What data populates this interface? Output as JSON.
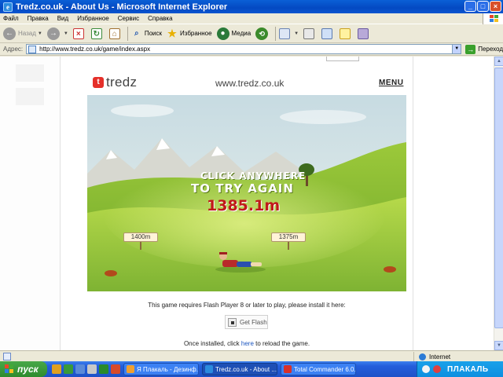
{
  "window": {
    "title": "Tredz.co.uk - About Us - Microsoft Internet Explorer"
  },
  "menubar": [
    "Файл",
    "Правка",
    "Вид",
    "Избранное",
    "Сервис",
    "Справка"
  ],
  "toolbar": {
    "back": "Назад",
    "search": "Поиск",
    "favorites": "Избранное",
    "media": "Медиа"
  },
  "addressbar": {
    "label": "Адрес:",
    "url": "http://www.tredz.co.uk/game/index.aspx",
    "go": "Переход"
  },
  "site": {
    "logo_text": "tredz",
    "url": "www.tredz.co.uk",
    "menu": "MENU"
  },
  "game": {
    "line1": "CLICK ANYWHERE",
    "line2": "TO TRY AGAIN",
    "score": "1385.1m",
    "marker_left": "1400m",
    "marker_right": "1375m"
  },
  "flash": {
    "message": "This game requires Flash Player 8 or later to play, please install it here:",
    "button": "Get Flash",
    "reload_prefix": "Once installed, click ",
    "reload_link": "here",
    "reload_suffix": " to reload the game."
  },
  "statusbar": {
    "zone": "Internet"
  },
  "taskbar": {
    "start": "пуск",
    "tasks": [
      {
        "label": "Я Плакаль - Дезинф...",
        "color": "#f0a030"
      },
      {
        "label": "Tredz.co.uk - About ...",
        "color": "#2b8bde"
      },
      {
        "label": "Total Commander 6.0...",
        "color": "#d8302a"
      }
    ],
    "tray_text": "ПЛАКАЛЬ"
  }
}
